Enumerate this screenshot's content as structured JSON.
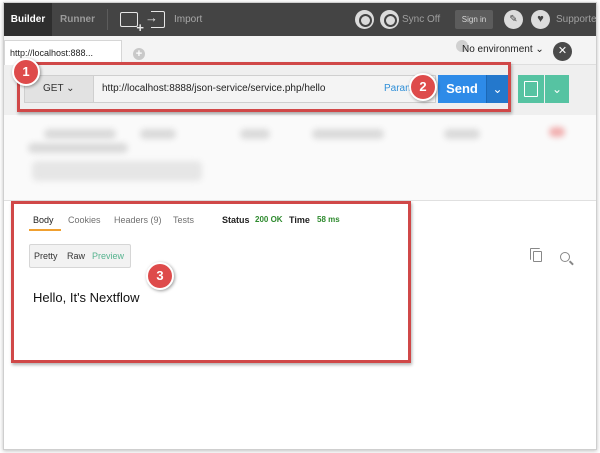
{
  "topbar": {
    "builder_tab": "Builder",
    "runner_tab": "Runner",
    "import_label": "Import",
    "sync_label": "Sync Off",
    "signin_label": "Sign in",
    "supporters_label": "Supporters"
  },
  "tabs": {
    "active_tab": "http://localhost:888..."
  },
  "environment": {
    "selected": "No environment"
  },
  "request": {
    "method": "GET",
    "url": "http://localhost:8888/json-service/service.php/hello",
    "params_label": "Params",
    "send_label": "Send"
  },
  "response": {
    "tabs": [
      {
        "label": "Body"
      },
      {
        "label": "Cookies"
      },
      {
        "label": "Headers (9)"
      },
      {
        "label": "Tests"
      }
    ],
    "status_label": "Status",
    "status_value": "200 OK",
    "time_label": "Time",
    "time_value": "58 ms",
    "formats": [
      "Pretty",
      "Raw",
      "Preview"
    ],
    "body": "Hello, It's Nextflow"
  },
  "annotations": [
    "1",
    "2",
    "3"
  ],
  "colors": {
    "send_blue": "#2e8be8",
    "save_green": "#56c3a2",
    "annotation_red": "#de4b4b",
    "status_green": "#2e8a2e"
  }
}
